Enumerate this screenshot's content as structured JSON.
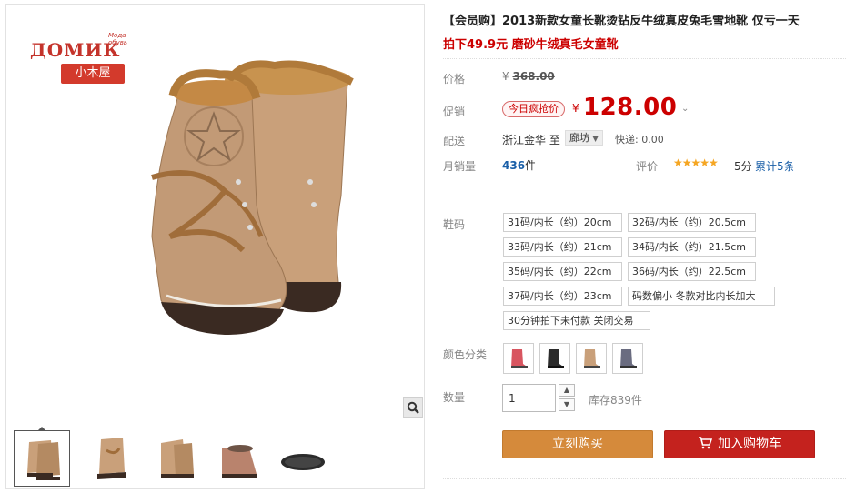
{
  "brand": {
    "sub": "Мода обувь",
    "main": "ДОМИК",
    "tag": "小木屋"
  },
  "product": {
    "title": "【会员购】2013新款女童长靴烫钻反牛绒真皮兔毛雪地靴 仅亏一天",
    "subtitle": "拍下49.9元 磨砂牛绒真毛女童靴"
  },
  "price_row": {
    "label": "价格",
    "symbol": "¥",
    "value": "368.00"
  },
  "promo_row": {
    "label": "促销",
    "badge": "今日疯抢价",
    "symbol": "¥",
    "value": "128.00",
    "toggle": "⌄"
  },
  "shipping": {
    "label": "配送",
    "from": "浙江金华 至",
    "to": "廊坊",
    "fee": "快递: 0.00"
  },
  "sales": {
    "label": "月销量",
    "count": "436",
    "unit": "件",
    "rate_label": "评价",
    "stars": "★★★★★",
    "score": "5分",
    "reviews": "累计5条"
  },
  "sizes": {
    "label": "鞋码",
    "options": [
      "31码/内长（约）20cm",
      "32码/内长（约）20.5cm",
      "33码/内长（约）21cm",
      "34码/内长（约）21.5cm",
      "35码/内长（约）22cm",
      "36码/内长（约）22.5cm",
      "37码/内长（约）23cm",
      "码数偏小 冬款对比内长加大",
      "30分钟拍下未付款 关闭交易"
    ]
  },
  "colors": {
    "label": "颜色分类",
    "swatches": [
      "#d85560",
      "#2b2b2b",
      "#c9a07a",
      "#6a6c80"
    ]
  },
  "quantity": {
    "label": "数量",
    "value": "1",
    "stock": "库存839件"
  },
  "actions": {
    "buy": "立刻购买",
    "cart": "加入购物车"
  },
  "accent_colors": {
    "price": "#cc0000",
    "buy": "#d58a3b",
    "cart": "#c4221e"
  }
}
